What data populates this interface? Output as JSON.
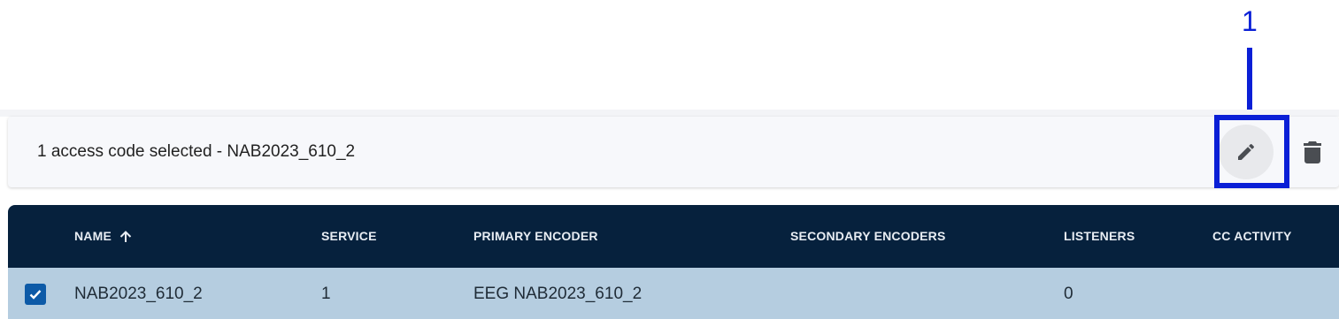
{
  "annotation": {
    "number": "1",
    "color": "#0a1fd6"
  },
  "selection_bar": {
    "text": "1 access code selected - NAB2023_610_2",
    "edit_icon": "pencil-icon",
    "delete_icon": "trash-icon"
  },
  "table": {
    "columns": [
      {
        "label": "NAME",
        "sort": "ascending"
      },
      {
        "label": "SERVICE"
      },
      {
        "label": "PRIMARY ENCODER"
      },
      {
        "label": "SECONDARY ENCODERS"
      },
      {
        "label": "LISTENERS"
      },
      {
        "label": "CC ACTIVITY"
      }
    ],
    "rows": [
      {
        "selected": true,
        "name": "NAB2023_610_2",
        "service": "1",
        "primary_encoder": "EEG NAB2023_610_2",
        "secondary_encoders": "",
        "listeners": "0",
        "cc_activity": ""
      }
    ]
  },
  "colors": {
    "header_bg": "#06213d",
    "selected_row_bg": "#b5cde0",
    "checkbox": "#0d5aa7"
  }
}
